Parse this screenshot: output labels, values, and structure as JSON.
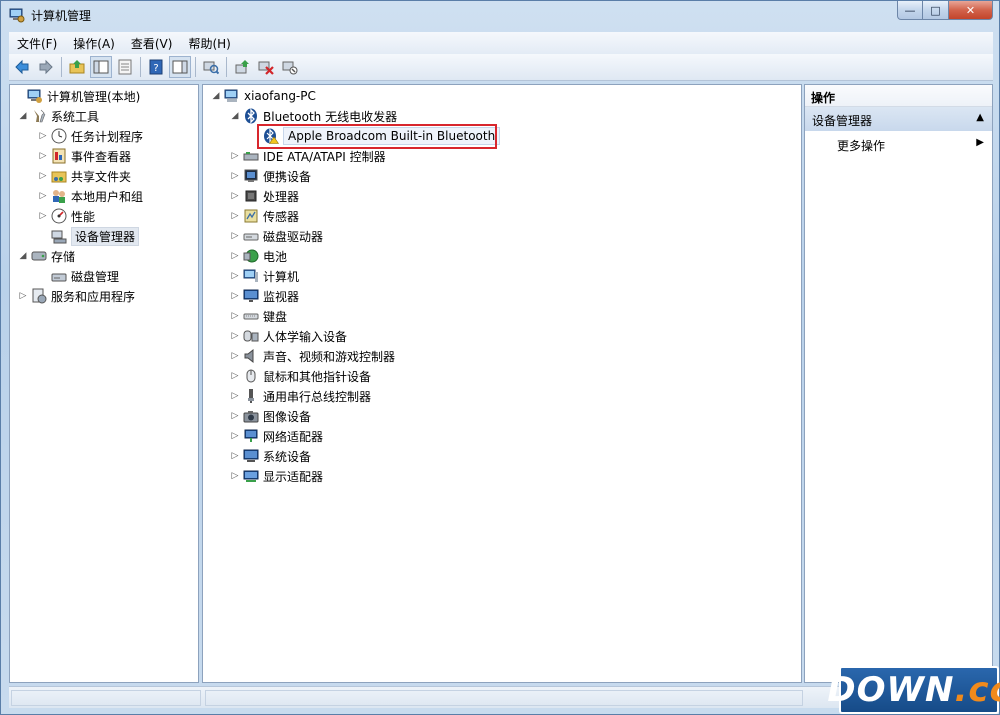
{
  "window": {
    "title": "计算机管理"
  },
  "window_buttons": {
    "minimize": "—",
    "maximize": "□",
    "close": "✕"
  },
  "menu": [
    "文件(F)",
    "操作(A)",
    "查看(V)",
    "帮助(H)"
  ],
  "toolbar_icons": [
    "back-icon",
    "forward-icon",
    "up-folder-icon",
    "show-hide-tree-icon",
    "properties-icon",
    "help-icon",
    "action-pane-icon",
    "scan-hardware-icon",
    "update-driver-icon",
    "uninstall-icon",
    "disable-icon"
  ],
  "left_tree": [
    {
      "label": "计算机管理(本地)",
      "icon": "computer-management-icon",
      "arrow": "",
      "level": 0
    },
    {
      "label": "系统工具",
      "icon": "system-tools-icon",
      "arrow": "◢",
      "level": 1
    },
    {
      "label": "任务计划程序",
      "icon": "clock-icon",
      "arrow": "▷",
      "level": 2
    },
    {
      "label": "事件查看器",
      "icon": "event-viewer-icon",
      "arrow": "▷",
      "level": 2
    },
    {
      "label": "共享文件夹",
      "icon": "shared-folder-icon",
      "arrow": "▷",
      "level": 2
    },
    {
      "label": "本地用户和组",
      "icon": "users-icon",
      "arrow": "▷",
      "level": 2
    },
    {
      "label": "性能",
      "icon": "performance-icon",
      "arrow": "▷",
      "level": 2
    },
    {
      "label": "设备管理器",
      "icon": "device-manager-icon",
      "arrow": "",
      "level": 2,
      "selected": true
    },
    {
      "label": "存储",
      "icon": "storage-icon",
      "arrow": "◢",
      "level": 1
    },
    {
      "label": "磁盘管理",
      "icon": "disk-management-icon",
      "arrow": "",
      "level": 2
    },
    {
      "label": "服务和应用程序",
      "icon": "services-icon",
      "arrow": "▷",
      "level": 1
    }
  ],
  "device_tree": {
    "root": "xiaofang-PC",
    "bluetooth_category": "Bluetooth 无线电收发器",
    "bluetooth_device": "Apple Broadcom Built-in Bluetooth",
    "categories": [
      "IDE ATA/ATAPI 控制器",
      "便携设备",
      "处理器",
      "传感器",
      "磁盘驱动器",
      "电池",
      "计算机",
      "监视器",
      "键盘",
      "人体学输入设备",
      "声音、视频和游戏控制器",
      "鼠标和其他指针设备",
      "通用串行总线控制器",
      "图像设备",
      "网络适配器",
      "系统设备",
      "显示适配器"
    ]
  },
  "actions": {
    "header": "操作",
    "section": "设备管理器",
    "more": "更多操作",
    "section_arrow": "▲",
    "more_arrow": "▶"
  },
  "tree_arrows": {
    "expanded": "◢",
    "collapsed": "▷"
  },
  "watermark": {
    "main": "DOWN",
    "suffix": ".cc"
  }
}
